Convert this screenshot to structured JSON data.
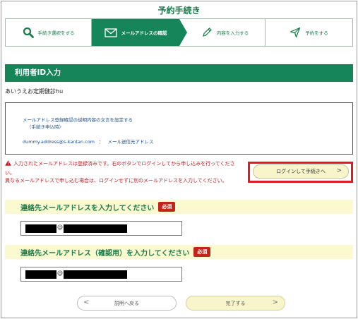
{
  "page_title": "予約手続き",
  "steps": [
    {
      "label": "手続き選択をする",
      "icon": "search-icon"
    },
    {
      "label": "メールアドレスの確認",
      "icon": "envelope-icon"
    },
    {
      "label": "内容を入力する",
      "icon": "pencil-icon"
    },
    {
      "label": "予約をする",
      "icon": "paper-plane-icon"
    }
  ],
  "section_title": "利用者ID入力",
  "course_name": "あいうえお定期健診hu",
  "info_box": {
    "line1": "メールアドレス登録確認の説明内容の文言を設定する",
    "line2": "（手続き申込時）",
    "email": "dummy.address@s-kantan.com",
    "separator": "：",
    "sender": "メール送信元アドレス"
  },
  "warning": {
    "line1": "入力されたメールアドレスは登録済みです。右のボタンでログインしてから申し込みを行ってください。",
    "line2": "異なるメールアドレスで申し込む場合は、ログインせずに別のメールアドレスを入力してください。"
  },
  "login_button": {
    "label": "ログインして手続きへ",
    "chevron": ">"
  },
  "email_field": {
    "label": "連絡先メールアドレスを入力してください",
    "required": "必須",
    "at": "@"
  },
  "email_confirm_field": {
    "label": "連絡先メールアドレス（確認用）を入力してください",
    "required": "必須",
    "at": "@"
  },
  "back_button": {
    "label": "説明へ戻る",
    "chevron": "<"
  },
  "next_button": {
    "label": "完了する",
    "chevron": ">"
  },
  "colors": {
    "brand_green": "#16855a",
    "required_red": "#c3241a",
    "highlight_red": "#e01b24",
    "button_cream": "#f7f5c9"
  }
}
